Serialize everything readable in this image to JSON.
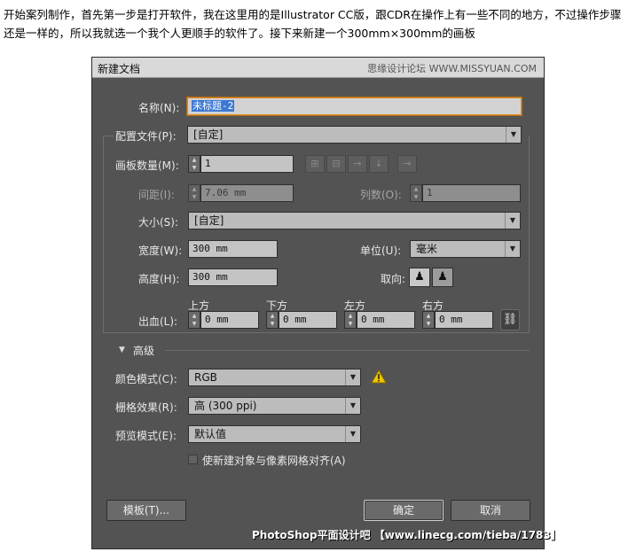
{
  "intro": "开始案列制作，首先第一步是打开软件，我在这里用的是Illustrator CC版，跟CDR在操作上有一些不同的地方，不过操作步骤还是一样的，所以我就选一个我个人更顺手的软件了。接下来新建一个300mm×300mm的画板",
  "dialog": {
    "title": "新建文档",
    "watermark_top": "思缘设计论坛 WWW.MISSYUAN.COM",
    "name_label": "名称(N):",
    "name_value": "未标题-2",
    "profile_label": "配置文件(P):",
    "profile_value": "[自定]",
    "artboards_label": "画板数量(M):",
    "artboards_value": "1",
    "spacing_label": "间距(I):",
    "spacing_value": "7.06 mm",
    "columns_label": "列数(O):",
    "columns_value": "1",
    "size_label": "大小(S):",
    "size_value": "[自定]",
    "width_label": "宽度(W):",
    "width_value": "300 mm",
    "units_label": "单位(U):",
    "units_value": "毫米",
    "height_label": "高度(H):",
    "height_value": "300 mm",
    "orientation_label": "取向:",
    "bleed_label": "出血(L):",
    "bleed_top_label": "上方",
    "bleed_bottom_label": "下方",
    "bleed_left_label": "左方",
    "bleed_right_label": "右方",
    "bleed_top": "0 mm",
    "bleed_bottom": "0 mm",
    "bleed_left": "0 mm",
    "bleed_right": "0 mm",
    "advanced_label": "高级",
    "color_mode_label": "颜色模式(C):",
    "color_mode_value": "RGB",
    "raster_label": "栅格效果(R):",
    "raster_value": "高 (300 ppi)",
    "preview_label": "预览模式(E):",
    "preview_value": "默认值",
    "align_checkbox_label": "使新建对象与像素网格对齐(A)",
    "templates_button": "模板(T)...",
    "ok_button": "确定",
    "cancel_button": "取消",
    "watermark_bottom": "PhotoShop平面设计吧 【www.linecg.com/tieba/1783】"
  }
}
